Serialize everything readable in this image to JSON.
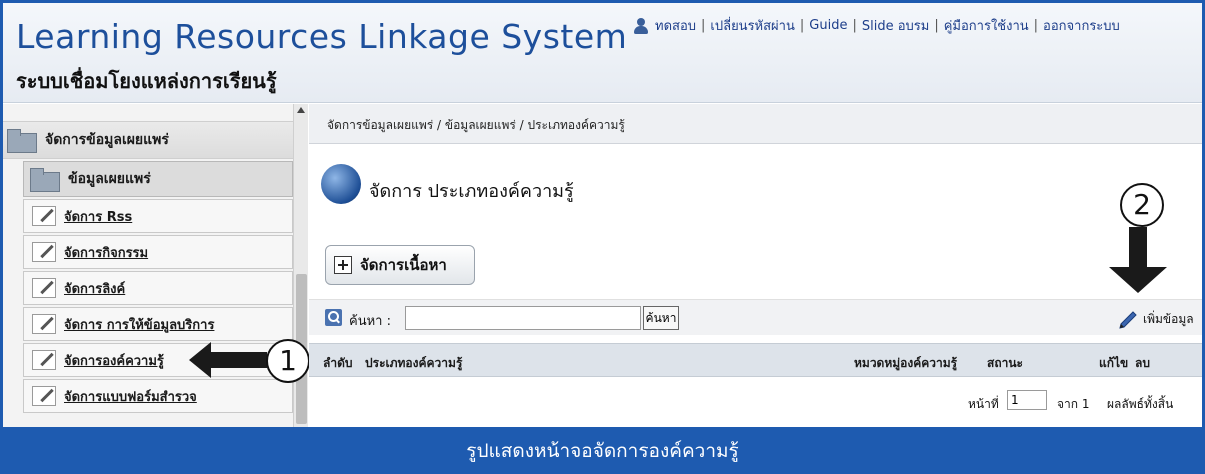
{
  "header": {
    "title": "Learning Resources Linkage System",
    "subtitle": "ระบบเชื่อมโยงแหล่งการเรียนรู้",
    "links": {
      "user": "ทดสอบ",
      "change_password": "เปลี่ยนรหัสผ่าน",
      "guide": "Guide",
      "slide": "Slide อบรม",
      "manual": "คู่มือการใช้งาน",
      "logout": "ออกจากระบบ"
    }
  },
  "sidebar": {
    "group_label": "จัดการข้อมูลเผยแพร่",
    "sub_label": "ข้อมูลเผยแพร่",
    "items": [
      {
        "label": "จัดการ Rss"
      },
      {
        "label": "จัดการกิจกรรม"
      },
      {
        "label": "จัดการลิงค์"
      },
      {
        "label": "จัดการ การให้ข้อมูลบริการ"
      },
      {
        "label": "จัดการองค์ความรู้"
      },
      {
        "label": "จัดการแบบฟอร์มสำรวจ"
      }
    ]
  },
  "callouts": {
    "one": "1",
    "two": "2"
  },
  "main": {
    "breadcrumb": "จัดการข้อมูลเผยแพร่ / ข้อมูลเผยแพร่ / ประเภทองค์ความรู้",
    "heading": "จัดการ ประเภทองค์ความรู้",
    "manage_button": "จัดการเนื้อหา",
    "search_label": "ค้นหา :",
    "search_value": "",
    "search_button": "ค้นหา",
    "add_label": "เพิ่มข้อมูล",
    "table_headers": {
      "no": "ลำดับ",
      "type": "ประเภทองค์ความรู้",
      "category": "หมวดหมู่องค์ความรู้",
      "status": "สถานะ",
      "edit": "แก้ไข",
      "delete": "ลบ"
    },
    "pager": {
      "page_label": "หน้าที่",
      "page_value": "1",
      "of_label": "จาก 1",
      "total_label": "ผลลัพธ์ทั้งสิ้น"
    }
  },
  "caption": "รูปแสดงหน้าจอจัดการองค์ความรู้",
  "colors": {
    "brand_blue": "#1e5bb0",
    "title_blue": "#1d4f9b"
  }
}
